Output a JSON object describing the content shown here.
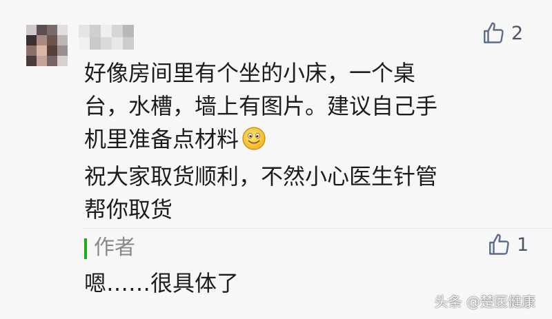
{
  "comment": {
    "likes": "2",
    "lines": [
      "好像房间里有个坐的小床，一个桌",
      "台，水槽，墙上有图片。建议自己手",
      "机里准备点材料",
      "祝大家取货顺利，不然小心医生针管",
      "帮你取货"
    ],
    "emoji_icon": "smiley-emoji-icon"
  },
  "reply": {
    "author_label": "作者",
    "likes": "1",
    "text": "嗯……很具体了"
  },
  "watermark": "头条 @楚医健康",
  "colors": {
    "background": "#f7f7f7",
    "text": "#1c1c1c",
    "author_bar": "#1aad19",
    "author_label": "#888888",
    "like_icon": "#5b6b8a"
  }
}
